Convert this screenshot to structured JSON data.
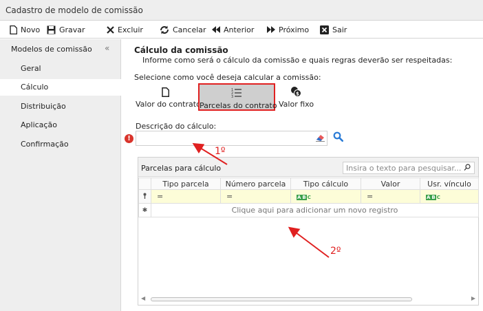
{
  "window": {
    "title": "Cadastro de modelo de comissão"
  },
  "toolbar": {
    "novo": "Novo",
    "gravar": "Gravar",
    "excluir": "Excluir",
    "cancelar": "Cancelar",
    "anterior": "Anterior",
    "proximo": "Próximo",
    "sair": "Sair"
  },
  "sidebar": {
    "header": "Modelos de comissão",
    "collapse_icon": "«",
    "items": [
      {
        "label": "Geral"
      },
      {
        "label": "Cálculo",
        "active": true
      },
      {
        "label": "Distribuição"
      },
      {
        "label": "Aplicação"
      },
      {
        "label": "Confirmação"
      }
    ]
  },
  "main": {
    "title": "Cálculo da comissão",
    "subtitle": "Informe como será o cálculo da comissão e quais regras deverão ser respeitadas:",
    "select_label": "Selecione como você deseja calcular a comissão:",
    "options": [
      {
        "label": "Valor do contrato",
        "icon": "document-icon",
        "selected": false
      },
      {
        "label": "Parcelas do contrato",
        "icon": "numbered-list-icon",
        "selected": true
      },
      {
        "label": "Valor fixo",
        "icon": "coins-icon",
        "selected": false
      }
    ],
    "description_label": "Descrição do cálculo:",
    "description_value": "",
    "grid": {
      "title": "Parcelas para cálculo",
      "search_placeholder": "Insira o texto para pesquisar...",
      "columns": [
        "Tipo parcela",
        "Número parcela",
        "Tipo cálculo",
        "Valor",
        "Usr. vínculo"
      ],
      "filter_row": [
        "=",
        "=",
        "ABC",
        "=",
        "ABC"
      ],
      "new_row_text": "Clique aqui para adicionar um novo registro"
    }
  },
  "annotations": {
    "first": "1º",
    "second": "2º",
    "color": "#e02020"
  },
  "colors": {
    "selection_border": "#e02020",
    "selected_bg": "#cfcfcf",
    "filter_row_bg": "#fdfdd8",
    "search_icon": "#2a7bd6"
  }
}
